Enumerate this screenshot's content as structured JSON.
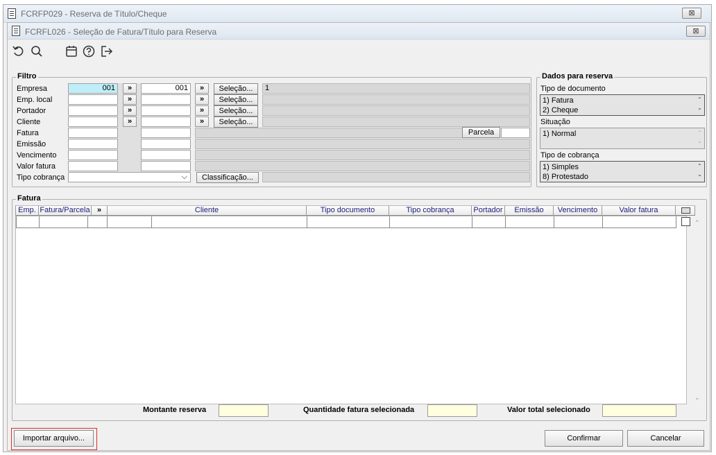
{
  "outer_window": {
    "title": "FCRFP029 - Reserva de Título/Cheque",
    "close_glyph": "⊠"
  },
  "inner_window": {
    "title": "FCRFL026 - Seleção de Fatura/Título para Reserva",
    "close_glyph": "⊠"
  },
  "toolbar": {
    "icons": [
      "undo-icon",
      "search-icon",
      "calendar-icon",
      "help-icon",
      "exit-icon"
    ]
  },
  "filtro": {
    "legend": "Filtro",
    "labels": {
      "empresa": "Empresa",
      "emp_local": "Emp. local",
      "portador": "Portador",
      "cliente": "Cliente",
      "fatura": "Fatura",
      "emissao": "Emissão",
      "vencimento": "Vencimento",
      "valor_fatura": "Valor fatura",
      "tipo_cobranca": "Tipo cobrança"
    },
    "empresa_from": "001",
    "empresa_to": "001",
    "empresa_desc": "1",
    "arrow_glyph": "»",
    "selecao_label": "Seleção...",
    "parcela_label": "Parcela",
    "classificacao_label": "Classificação...",
    "dropdown_glyph": "⌵"
  },
  "dados_reserva": {
    "legend": "Dados para reserva",
    "tipo_documento_label": "Tipo de documento",
    "tipo_documento_items": [
      "1) Fatura",
      "2) Cheque"
    ],
    "situacao_label": "Situação",
    "situacao_items": [
      "1) Normal"
    ],
    "tipo_cobranca_label": "Tipo de cobrança",
    "tipo_cobranca_items": [
      "1) Simples",
      "8) Protestado"
    ],
    "scroll_up": "⌃",
    "scroll_down": "⌄"
  },
  "fatura": {
    "legend": "Fatura",
    "columns": [
      "Emp.",
      "Fatura/Parcela",
      "»",
      "Cliente",
      "Tipo documento",
      "Tipo cobrança",
      "Portador",
      "Emissão",
      "Vencimento",
      "Valor fatura"
    ],
    "montante_label": "Montante reserva",
    "quantidade_label": "Quantidade fatura selecionada",
    "valor_total_label": "Valor total selecionado"
  },
  "buttons": {
    "importar": "Importar arquivo...",
    "confirmar": "Confirmar",
    "cancelar": "Cancelar"
  },
  "colors": {
    "highlight_border": "#d9302c",
    "cyan_field": "#bfeef8",
    "yellow_field": "#ffffe0"
  }
}
